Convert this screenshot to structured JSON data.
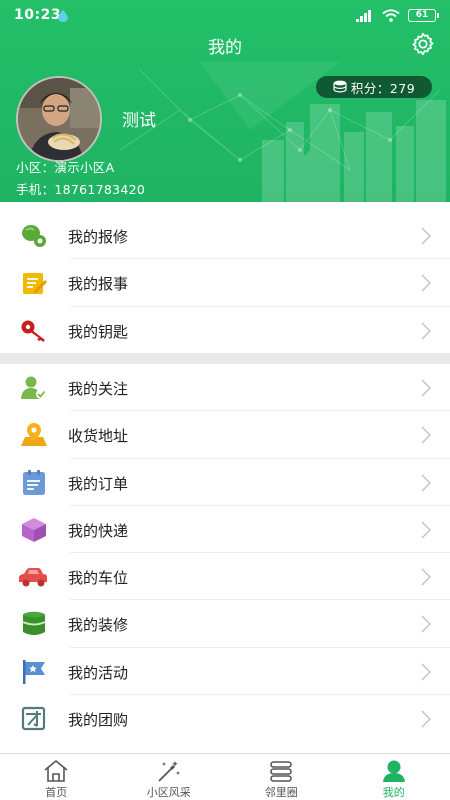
{
  "status_bar": {
    "time": "10:23",
    "battery": "61"
  },
  "header": {
    "title": "我的",
    "points_label": "积分：279",
    "username": "测试",
    "community": "小区：演示小区A",
    "phone": "手机：18761783420"
  },
  "colors": {
    "brand_green": "#1fb463",
    "points_badge": "#0f5a33"
  },
  "menu_group_1": [
    {
      "label": "我的报修",
      "icon": "repair-wrench-icon"
    },
    {
      "label": "我的报事",
      "icon": "report-notepad-icon"
    },
    {
      "label": "我的钥匙",
      "icon": "key-icon"
    }
  ],
  "menu_group_2": [
    {
      "label": "我的关注",
      "icon": "follow-user-icon"
    },
    {
      "label": "收货地址",
      "icon": "address-pin-icon"
    },
    {
      "label": "我的订单",
      "icon": "order-list-icon"
    },
    {
      "label": "我的快递",
      "icon": "parcel-box-icon"
    },
    {
      "label": "我的车位",
      "icon": "car-icon"
    },
    {
      "label": "我的装修",
      "icon": "renovation-bucket-icon"
    },
    {
      "label": "我的活动",
      "icon": "activity-flag-icon"
    },
    {
      "label": "我的团购",
      "icon": "group-buy-icon"
    }
  ],
  "tabs": [
    {
      "label": "首页",
      "icon": "home-icon",
      "active": false
    },
    {
      "label": "小区风采",
      "icon": "magic-wand-icon",
      "active": false
    },
    {
      "label": "邻里圈",
      "icon": "neighborhood-icon",
      "active": false
    },
    {
      "label": "我的",
      "icon": "profile-icon",
      "active": true
    }
  ]
}
